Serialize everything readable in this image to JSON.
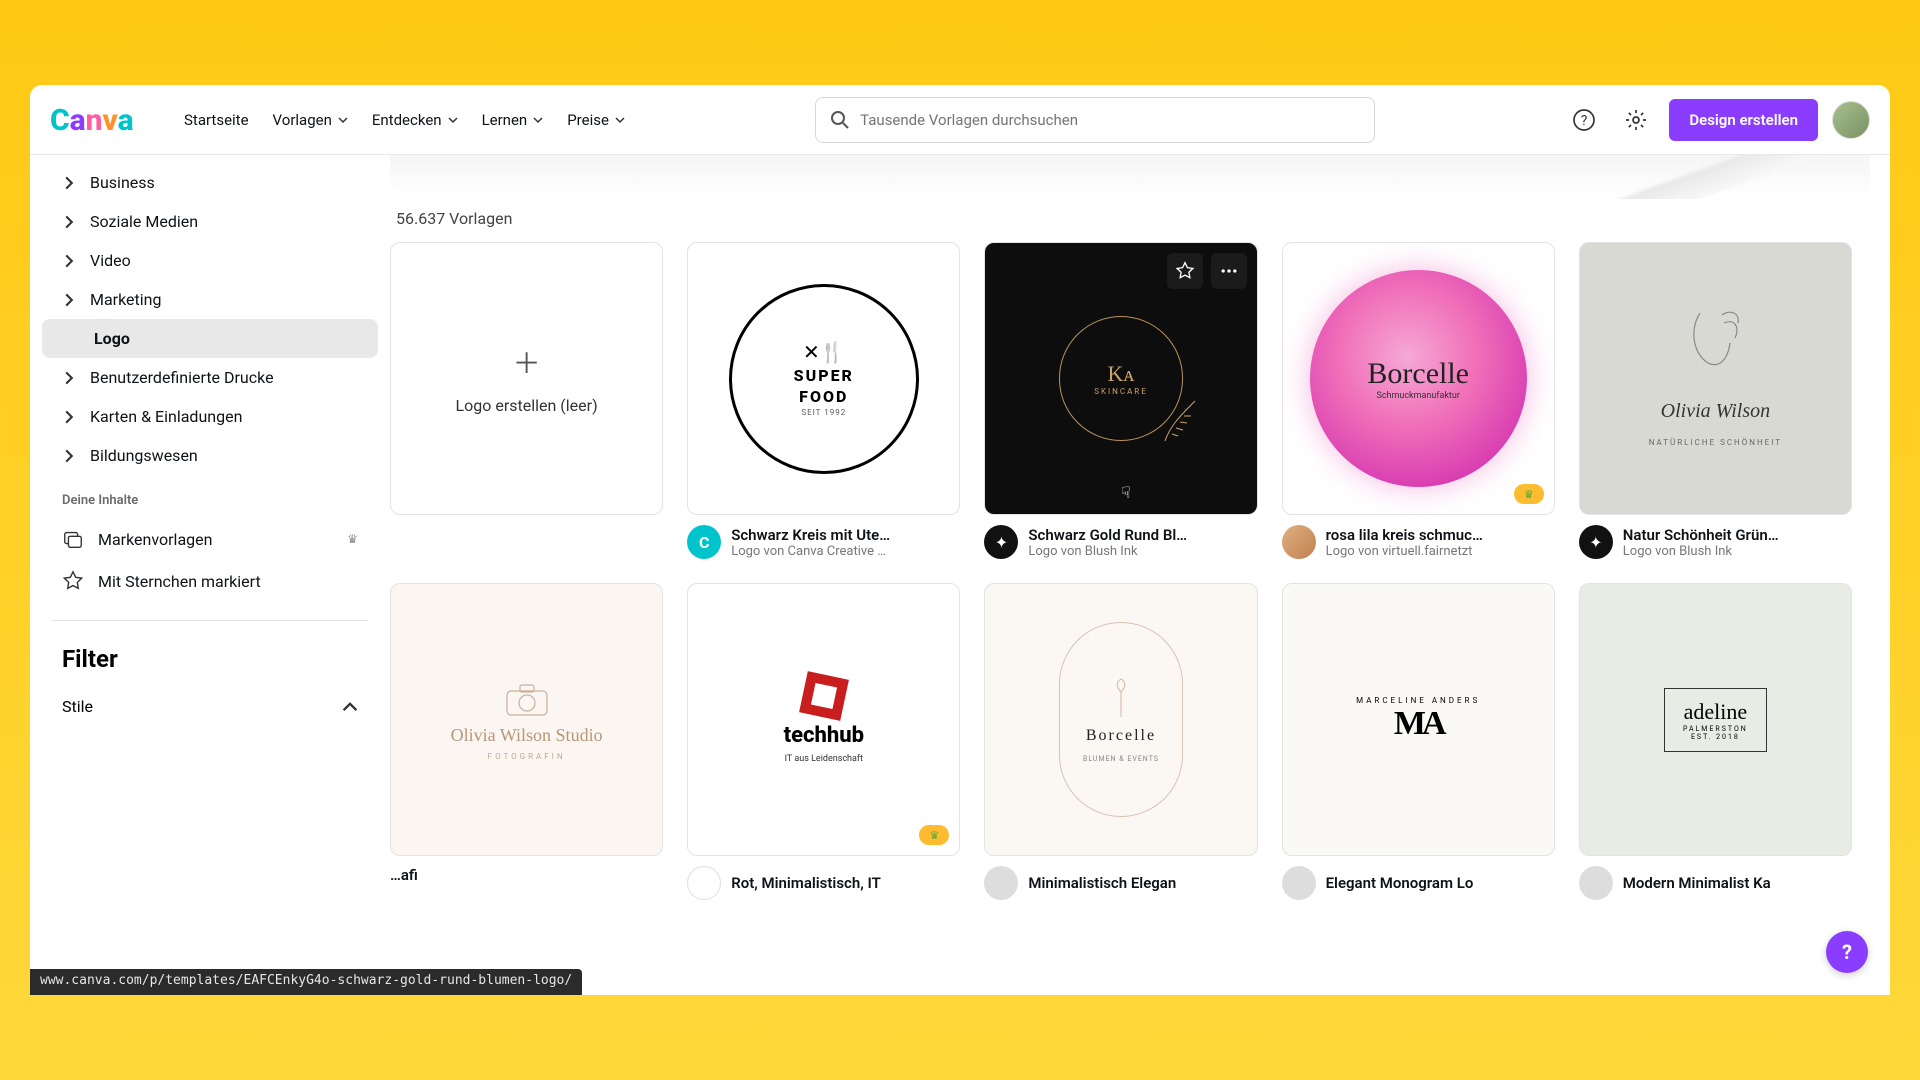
{
  "nav": {
    "home": "Startseite",
    "templates": "Vorlagen",
    "discover": "Entdecken",
    "learn": "Lernen",
    "prices": "Preise"
  },
  "search": {
    "placeholder": "Tausende Vorlagen durchsuchen"
  },
  "header": {
    "create": "Design erstellen"
  },
  "sidebar": {
    "cats": {
      "business": "Business",
      "social": "Soziale Medien",
      "video": "Video",
      "marketing": "Marketing",
      "logo": "Logo",
      "custom": "Benutzerdefinierte Drucke",
      "cards": "Karten & Einladungen",
      "education": "Bildungswesen"
    },
    "your_content": "Deine Inhalte",
    "brand_templates": "Markenvorlagen",
    "starred": "Mit Sternchen markiert",
    "filter": "Filter",
    "style": "Stile"
  },
  "main": {
    "count": "56.637 Vorlagen",
    "blank": "Logo erstellen (leer)"
  },
  "cards": [
    {
      "title": "Schwarz Kreis mit Ute…",
      "sub": "Logo von Canva Creative …",
      "avatar_bg": "#00c4cc"
    },
    {
      "title": "Schwarz Gold Rund Bl…",
      "sub": "Logo von Blush Ink",
      "avatar_bg": "#111"
    },
    {
      "title": "rosa lila kreis schmuc…",
      "sub": "Logo von virtuell.fairnetzt",
      "avatar_bg": "#d8a070"
    },
    {
      "title": "Natur Schönheit Grün…",
      "sub": "Logo von Blush Ink",
      "avatar_bg": "#111"
    },
    {
      "title": "…afi",
      "sub": "",
      "avatar_bg": "#ccc"
    },
    {
      "title": "Rot, Minimalistisch, IT",
      "sub": "",
      "avatar_bg": "#fff"
    },
    {
      "title": "Minimalistisch Elegan",
      "sub": "",
      "avatar_bg": "#ddd"
    },
    {
      "title": "Elegant Monogram Lo",
      "sub": "",
      "avatar_bg": "#ddd"
    },
    {
      "title": "Modern Minimalist Ka",
      "sub": "",
      "avatar_bg": "#ddd"
    }
  ],
  "thumb_text": {
    "super1": "SUPER",
    "super2": "FOOD",
    "super3": "SEIT 1992",
    "ka1": "Kᴀ",
    "ka2": "SKINCARE",
    "bor1": "Borcelle",
    "bor2": "Schmuckmanufaktur",
    "oli1": "Olivia Wilson",
    "oli2": "NATÜRLICHE SCHÖNHEIT",
    "stu1": "Olivia Wilson Studio",
    "stu2": "FOTOGRAFIN",
    "tech1": "techhub",
    "tech2": "IT aus Leidenschaft",
    "bc1": "Borcelle",
    "bc2": "BLUMEN & EVENTS",
    "mono1": "MARCELINE ANDERS",
    "mono2": "MA",
    "adel1": "adeline",
    "adel2": "PALMERSTON",
    "adel3": "EST. 2018"
  },
  "status_url": "www.canva.com/p/templates/EAFCEnkyG4o-schwarz-gold-rund-blumen-logo/",
  "help": "?"
}
